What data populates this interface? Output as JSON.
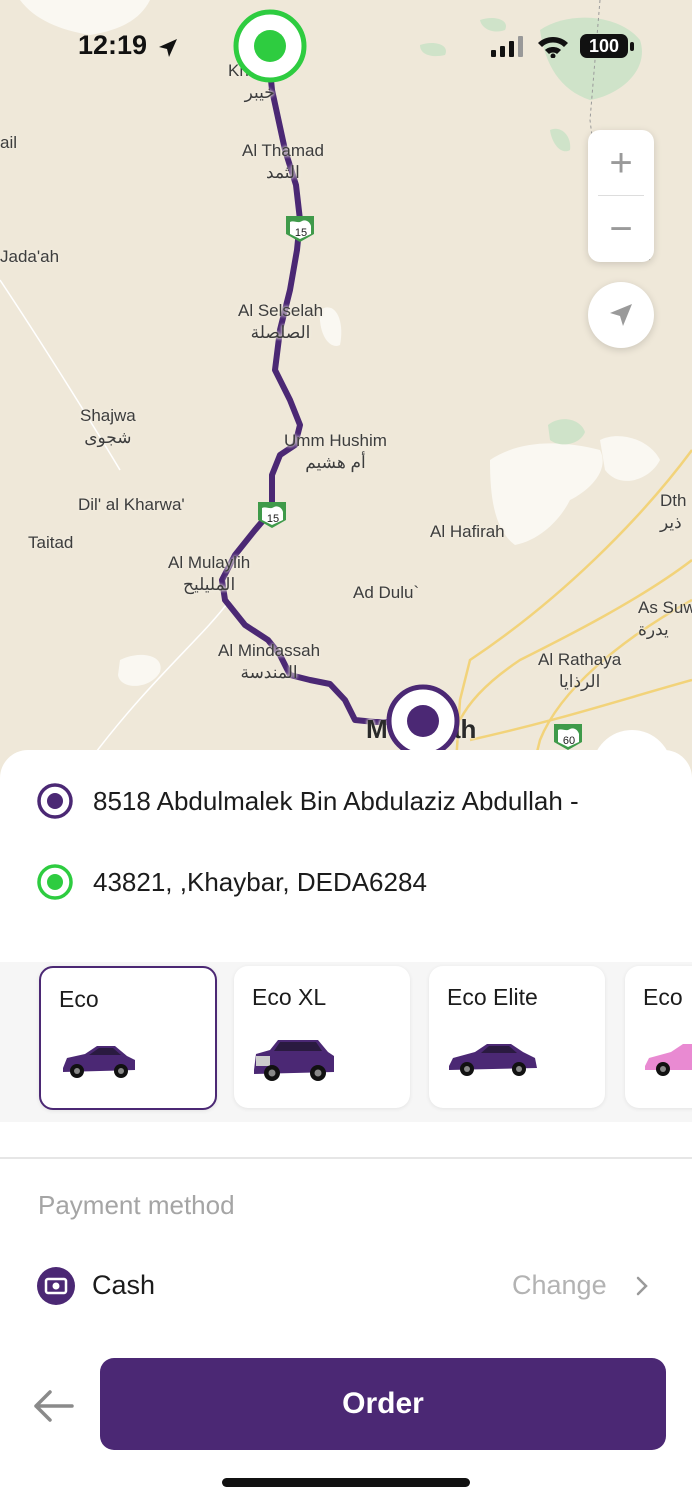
{
  "status_bar": {
    "time": "12:19",
    "battery": "100"
  },
  "map": {
    "places": [
      {
        "id": "khaybar",
        "en": "Khaybar",
        "ar": "خيبر"
      },
      {
        "id": "thamad",
        "en": "Al Thamad",
        "ar": "الثمد"
      },
      {
        "id": "jadaah",
        "en": "Jada'ah",
        "ar": ""
      },
      {
        "id": "selselah",
        "en": "Al Selselah",
        "ar": "الصلصلة"
      },
      {
        "id": "shajwa",
        "en": "Shajwa",
        "ar": "شجوى"
      },
      {
        "id": "ummhushim",
        "en": "Umm Hushim",
        "ar": "أم هشيم"
      },
      {
        "id": "dilkharwa",
        "en": "Dil' al Kharwa'",
        "ar": ""
      },
      {
        "id": "taitad",
        "en": "Taitad",
        "ar": ""
      },
      {
        "id": "hafirah",
        "en": "Al Hafirah",
        "ar": ""
      },
      {
        "id": "mulaylih",
        "en": "Al Mulaylih",
        "ar": "المليليح"
      },
      {
        "id": "addulu",
        "en": "Ad Dulu`",
        "ar": ""
      },
      {
        "id": "mindassah",
        "en": "Al Mindassah",
        "ar": "المندسة"
      },
      {
        "id": "rathaya",
        "en": "Al Rathaya",
        "ar": "الرذايا"
      },
      {
        "id": "assuw",
        "en": "As Suw",
        "ar": "يدرة"
      },
      {
        "id": "dth",
        "en": "Dth",
        "ar": "ذير"
      },
      {
        "id": "madinah",
        "en": "M",
        "ar": "ah"
      },
      {
        "id": "jail",
        "en": "ail",
        "ar": ""
      }
    ],
    "road_shields": [
      "15",
      "15",
      "60"
    ],
    "zoom_in": "+",
    "zoom_out": "−",
    "route_color": "#4b2874",
    "origin_color": "#2ecc40"
  },
  "trip": {
    "destination": "8518 Abdulmalek Bin Abdulaziz Abdullah -",
    "pickup": "43821, ,Khaybar, DEDA6284"
  },
  "vehicles": [
    {
      "name": "Eco",
      "selected": true,
      "color": "#4b2874"
    },
    {
      "name": "Eco XL",
      "selected": false,
      "color": "#4b2874"
    },
    {
      "name": "Eco Elite",
      "selected": false,
      "color": "#4b2874"
    },
    {
      "name": "Eco",
      "selected": false,
      "color": "#e98ad2"
    }
  ],
  "payment": {
    "label": "Payment method",
    "method": "Cash",
    "change_label": "Change"
  },
  "actions": {
    "order_label": "Order"
  },
  "colors": {
    "accent": "#4b2874",
    "map_bg": "#efe8d9"
  }
}
